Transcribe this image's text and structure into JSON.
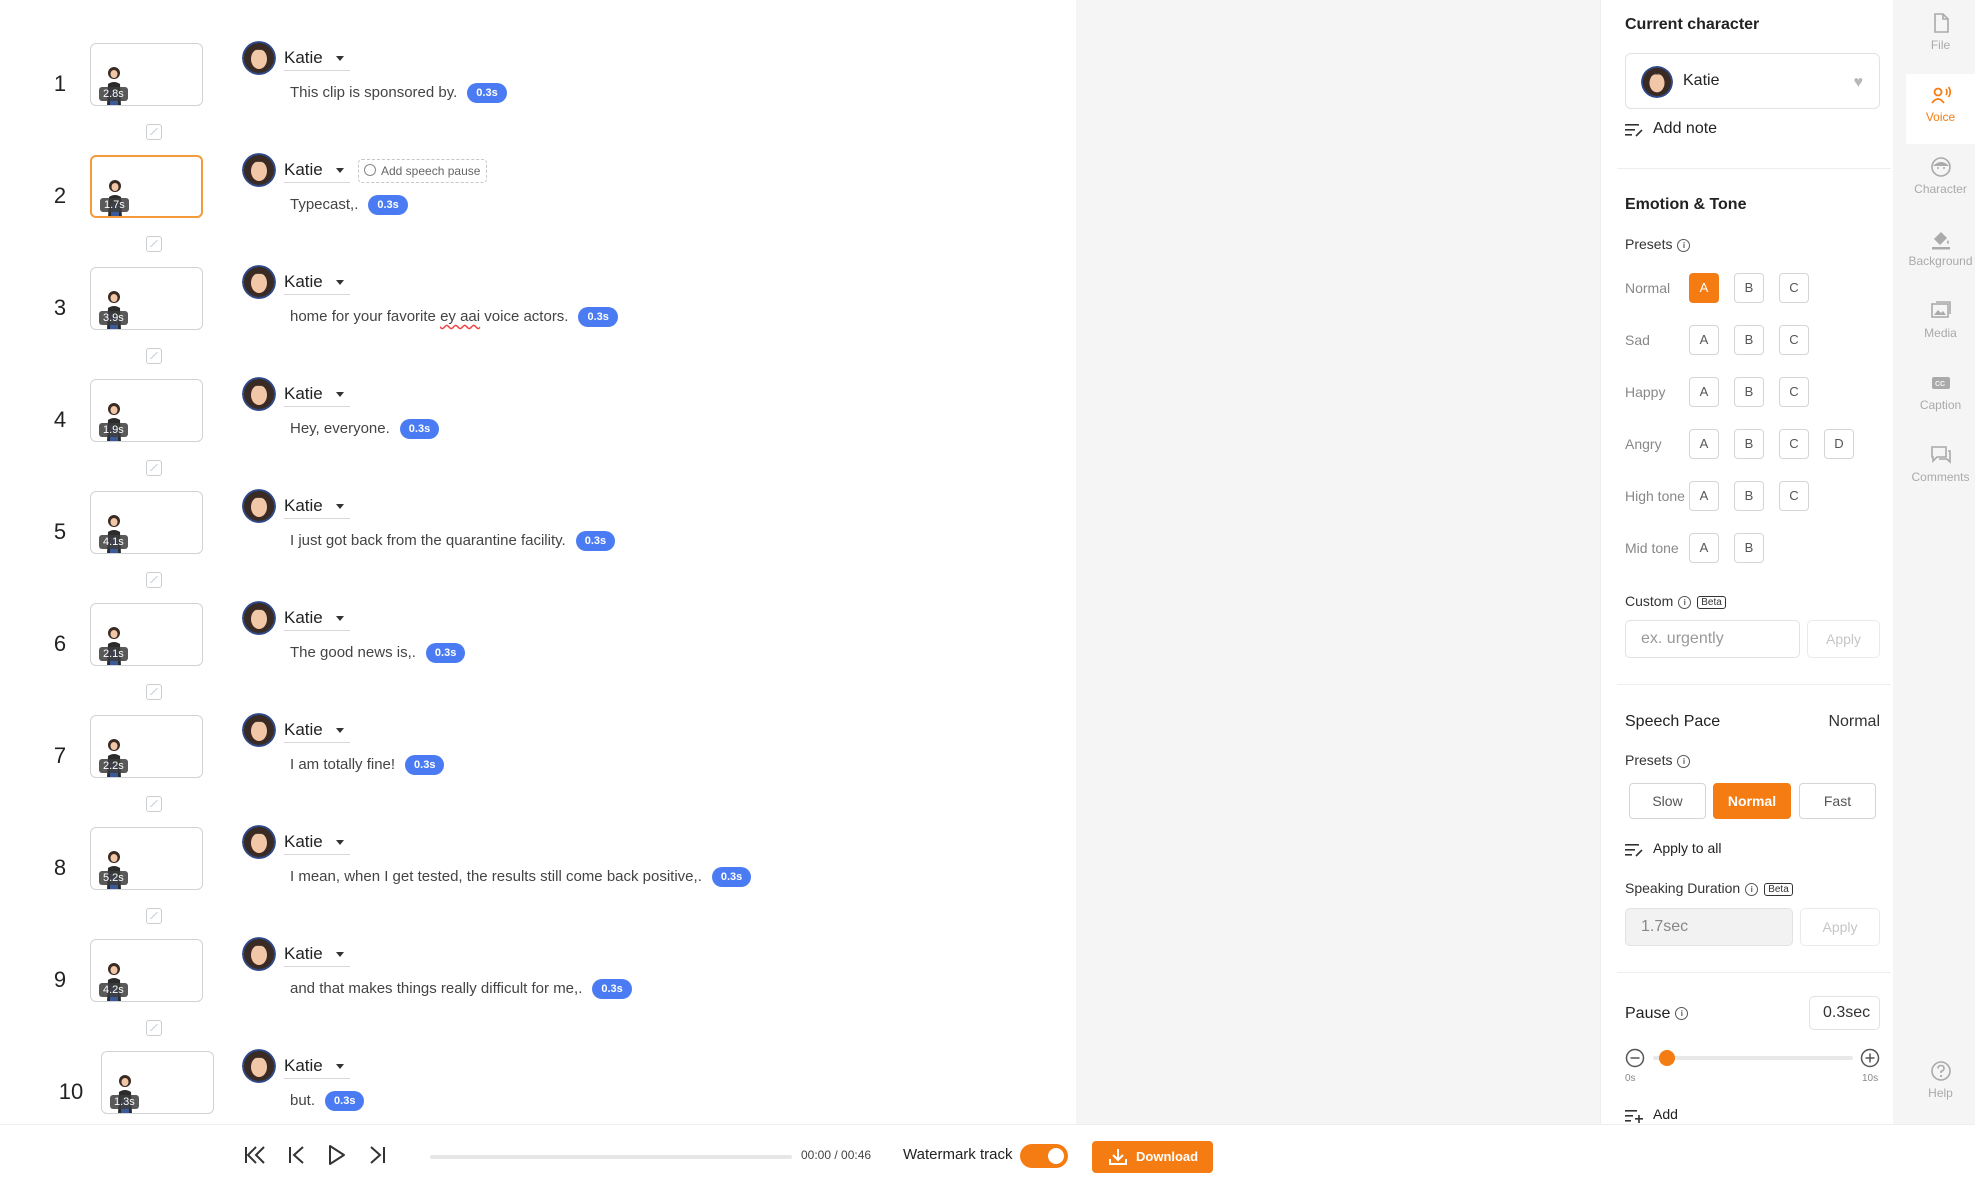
{
  "lines": [
    {
      "num": "1",
      "duration": "2.8s",
      "character": "Katie",
      "text": "This clip is sponsored by.",
      "pause": "0.3s"
    },
    {
      "num": "2",
      "duration": "1.7s",
      "character": "Katie",
      "text": "Typecast,.",
      "pause": "0.3s",
      "speech_pause_label": "Add speech pause"
    },
    {
      "num": "3",
      "duration": "3.9s",
      "character": "Katie",
      "text_before": "home for your favorite ",
      "text_flagged": "ey aai",
      "text_after": " voice actors.",
      "pause": "0.3s"
    },
    {
      "num": "4",
      "duration": "1.9s",
      "character": "Katie",
      "text": "Hey, everyone.",
      "pause": "0.3s"
    },
    {
      "num": "5",
      "duration": "4.1s",
      "character": "Katie",
      "text": "I just got back from the quarantine facility.",
      "pause": "0.3s"
    },
    {
      "num": "6",
      "duration": "2.1s",
      "character": "Katie",
      "text": "The good news is,.",
      "pause": "0.3s"
    },
    {
      "num": "7",
      "duration": "2.2s",
      "character": "Katie",
      "text": "I am totally fine!",
      "pause": "0.3s"
    },
    {
      "num": "8",
      "duration": "5.2s",
      "character": "Katie",
      "text": "I mean, when I get tested, the results still come back positive,.",
      "pause": "0.3s"
    },
    {
      "num": "9",
      "duration": "4.2s",
      "character": "Katie",
      "text": "and that makes things really difficult for me,.",
      "pause": "0.3s"
    },
    {
      "num": "10",
      "duration": "1.3s",
      "character": "Katie",
      "text": "but.",
      "pause": "0.3s"
    }
  ],
  "panel": {
    "current_character_title": "Current character",
    "current_character": "Katie",
    "add_note": "Add note",
    "emotion_title": "Emotion & Tone",
    "presets_label": "Presets",
    "emotions": [
      {
        "name": "Normal",
        "options": [
          "A",
          "B",
          "C"
        ]
      },
      {
        "name": "Sad",
        "options": [
          "A",
          "B",
          "C"
        ]
      },
      {
        "name": "Happy",
        "options": [
          "A",
          "B",
          "C"
        ]
      },
      {
        "name": "Angry",
        "options": [
          "A",
          "B",
          "C",
          "D"
        ]
      },
      {
        "name": "High tone",
        "options": [
          "A",
          "B",
          "C"
        ]
      },
      {
        "name": "Mid tone",
        "options": [
          "A",
          "B"
        ]
      }
    ],
    "selected_emotion": "Normal A",
    "custom_label": "Custom",
    "beta": "Beta",
    "custom_placeholder": "ex. urgently",
    "apply": "Apply",
    "speech_pace_title": "Speech Pace",
    "speech_pace_value": "Normal",
    "pace_presets": [
      "Slow",
      "Normal",
      "Fast"
    ],
    "selected_pace": "Normal",
    "apply_to_all": "Apply to all",
    "speaking_duration_label": "Speaking Duration",
    "speaking_duration_value": "1.7sec",
    "pause_label": "Pause",
    "pause_value": "0.3sec",
    "pause_slider_fraction": 0.03,
    "slider_min": "0s",
    "slider_max": "10s",
    "add": "Add"
  },
  "toolbar": [
    {
      "label": "File",
      "icon": "file-icon"
    },
    {
      "label": "Voice",
      "icon": "voice-icon",
      "active": true
    },
    {
      "label": "Character",
      "icon": "character-icon"
    },
    {
      "label": "Background",
      "icon": "paint-bucket-icon"
    },
    {
      "label": "Media",
      "icon": "media-icon"
    },
    {
      "label": "Caption",
      "icon": "caption-icon"
    },
    {
      "label": "Comments",
      "icon": "comments-icon"
    },
    {
      "label": "Help",
      "icon": "help-icon"
    }
  ],
  "playback": {
    "timecode": "00:00 / 00:46",
    "watermark_label": "Watermark track",
    "watermark_on": true,
    "download": "Download"
  },
  "colors": {
    "accent": "#f57c12",
    "pill": "#4a7bf2"
  }
}
